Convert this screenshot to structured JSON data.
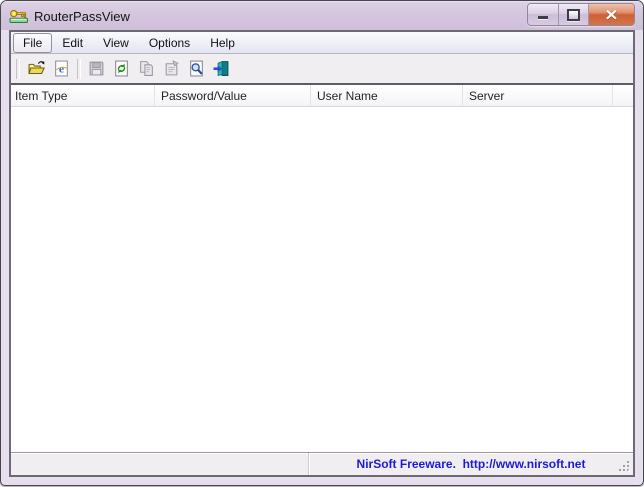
{
  "window": {
    "title": "RouterPassView",
    "controls": [
      {
        "name": "minimize"
      },
      {
        "name": "maximize"
      },
      {
        "name": "close"
      }
    ]
  },
  "menubar": {
    "items": [
      "File",
      "Edit",
      "View",
      "Options",
      "Help"
    ],
    "active_item": "File"
  },
  "toolbar": {
    "buttons": [
      {
        "icon": "open-folder-icon",
        "enabled": true
      },
      {
        "icon": "internet-explorer-icon",
        "enabled": true
      },
      {
        "icon": "save-floppy-icon",
        "enabled": false
      },
      {
        "icon": "refresh-icon",
        "enabled": true
      },
      {
        "icon": "copy-icon",
        "enabled": false
      },
      {
        "icon": "properties-icon",
        "enabled": false
      },
      {
        "icon": "find-icon",
        "enabled": true
      },
      {
        "icon": "exit-door-icon",
        "enabled": true
      }
    ]
  },
  "list": {
    "columns": [
      "Item Type",
      "Password/Value",
      "User Name",
      "Server"
    ],
    "rows": []
  },
  "statusbar": {
    "message": "NirSoft Freeware.  http://www.nirsoft.net"
  },
  "colors": {
    "titlebar": "#d3c5dc",
    "chrome": "#f0eef1",
    "menubar_gradient_bottom": "#e2e5f2",
    "status_text": "#1b1bd6",
    "close_button": "#ce6038",
    "refresh_green": "#169016",
    "find_blue": "#23479c",
    "exit_teal": "#15948e"
  }
}
